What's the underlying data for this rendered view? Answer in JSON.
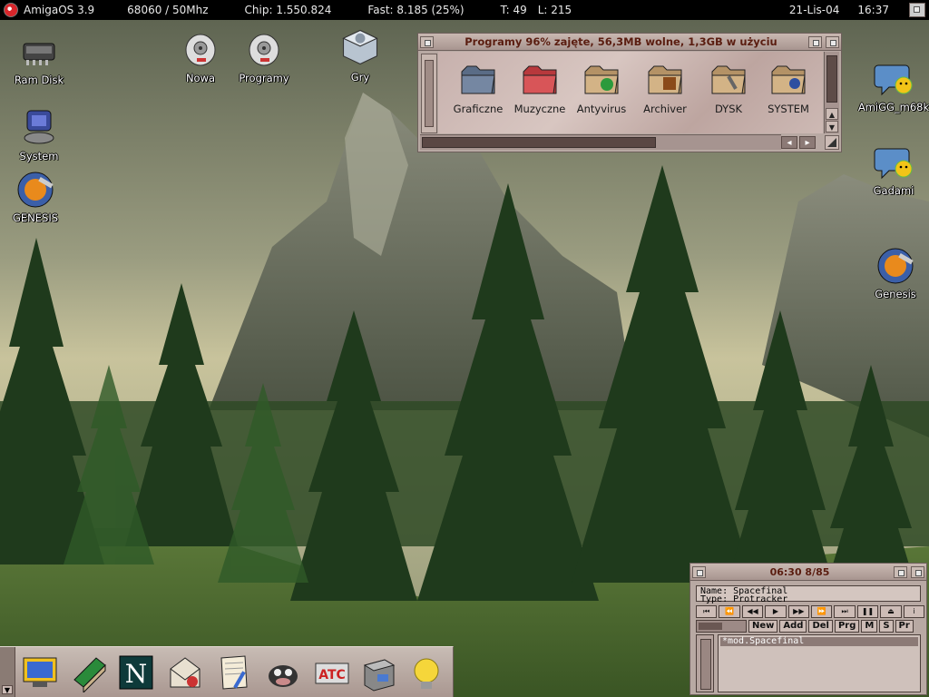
{
  "menubar": {
    "os": "AmigaOS 3.9",
    "cpu": "68060 / 50Mhz",
    "chip": "Chip: 1.550.824",
    "fast": "Fast: 8.185 (25%)",
    "tasks": "T: 49",
    "libs": "L: 215",
    "date": "21-Lis-04",
    "time": "16:37"
  },
  "desktop_icons": {
    "ramdisk": "Ram Disk",
    "nowa": "Nowa",
    "programy": "Programy",
    "gry": "Gry",
    "system": "System",
    "genesis_left": "GENESIS",
    "amigg": "AmiGG_m68k",
    "gadami": "Gadami",
    "genesis_right": "Genesis"
  },
  "drawer": {
    "title": "Programy   96% zajęte, 56,3MB wolne, 1,3GB w użyciu",
    "items": [
      {
        "label": "Graficzne",
        "color": "#5a6c86"
      },
      {
        "label": "Muzyczne",
        "color": "#b8383c"
      },
      {
        "label": "Antyvirus",
        "color": "#b49266"
      },
      {
        "label": "Archiver",
        "color": "#b49266"
      },
      {
        "label": "DYSK",
        "color": "#b49266"
      },
      {
        "label": "SYSTEM",
        "color": "#b49266"
      }
    ]
  },
  "player": {
    "title": "06:30 8/85",
    "name_line": "Name: Spacefinal",
    "type_line": "Type: Protracker",
    "buttons": {
      "new": "New",
      "add": "Add",
      "del": "Del",
      "prg": "Prg",
      "m": "M",
      "s": "S",
      "pr": "Pr"
    },
    "playlist": [
      "*mod.Spacefinal"
    ]
  },
  "dock": {
    "items": [
      "screen-mode-icon",
      "book-icon",
      "netscape-icon",
      "mail-icon",
      "notepad-icon",
      "cow-icon",
      "atc-icon",
      "cabinet-icon",
      "lightbulb-icon"
    ]
  }
}
